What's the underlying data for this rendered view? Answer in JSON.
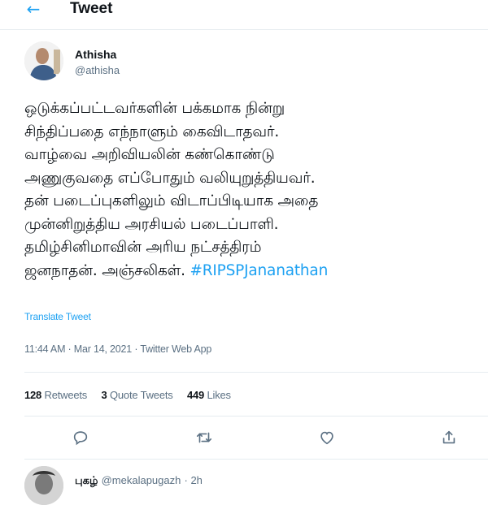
{
  "header": {
    "title": "Tweet"
  },
  "tweet": {
    "author_name": "Athisha",
    "author_handle": "@athisha",
    "text_lines": [
      "ஒடுக்கப்பட்டவர்களின் பக்கமாக நின்று",
      "சிந்திப்பதை எந்நாளும் கைவிடாதவர்.",
      "வாழ்வை அறிவியலின் கண்கொண்டு",
      "அணுகுவதை எப்போதும் வலியுறுத்தியவர்.",
      "தன் படைப்புகளிலும் விடாப்பிடியாக அதை",
      "முன்னிறுத்திய அரசியல் படைப்பாளி.",
      "தமிழ்சினிமாவின் அரிய நட்சத்திரம்",
      "ஜனநாதன். அஞ்சலிகள். "
    ],
    "hashtag": "#RIPSPJananathan",
    "translate_label": "Translate Tweet",
    "timestamp": "11:44 AM · Mar 14, 2021 · Twitter Web App",
    "stats": {
      "retweets_count": "128",
      "retweets_label": "Retweets",
      "quote_count": "3",
      "quote_label": "Quote Tweets",
      "likes_count": "449",
      "likes_label": "Likes"
    }
  },
  "actions": [
    "reply-icon",
    "retweet-icon",
    "like-icon",
    "share-icon"
  ],
  "reply": {
    "name": "புகழ்",
    "handle": "@mekalapugazh",
    "time": "· 2h"
  },
  "colors": {
    "accent": "#1da1f2",
    "secondary_text": "#5b7083",
    "divider": "#e6ecf0"
  }
}
